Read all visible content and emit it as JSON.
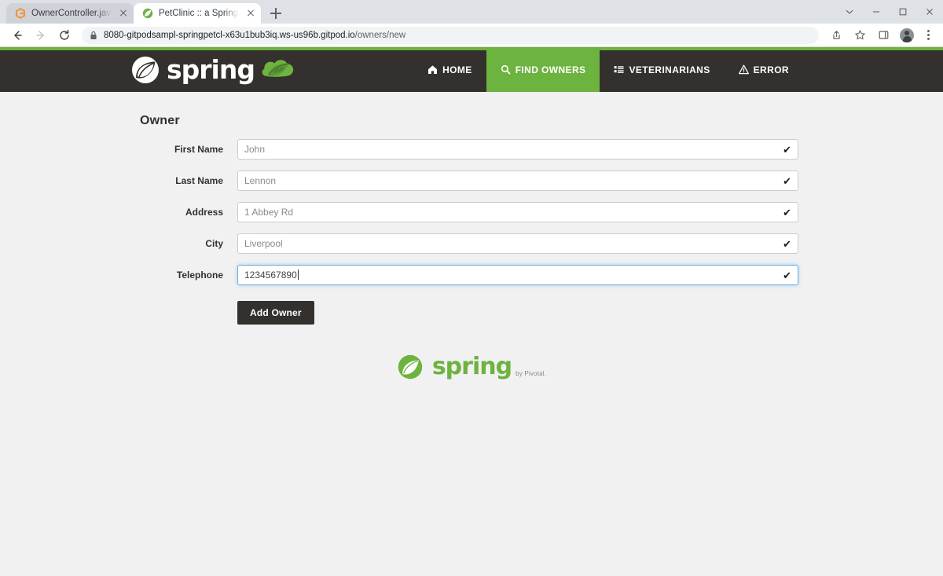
{
  "browser": {
    "tabs": [
      {
        "title": "OwnerController.java - spring-pe",
        "favicon": "gitpod-icon",
        "active": false
      },
      {
        "title": "PetClinic :: a Spring Framework d",
        "favicon": "spring-leaf-icon",
        "active": true
      }
    ],
    "new_tab_label": "+",
    "window_controls": [
      "chevron-down-icon",
      "minimize-icon",
      "maximize-icon",
      "close-icon"
    ],
    "nav_buttons": [
      "back-icon",
      "forward-icon",
      "reload-icon"
    ],
    "omnibox": {
      "lock_icon": "lock-icon",
      "host": "8080-gitpodsampl-springpetcl-x63u1bub3iq.ws-us96b.gitpod.io",
      "path": "/owners/new"
    },
    "toolbar_icons": [
      "share-icon",
      "bookmark-star-icon",
      "sidepanel-icon",
      "avatar",
      "kebab-menu-icon"
    ]
  },
  "site": {
    "brand": {
      "wordmark": "spring",
      "logo_icon": "spring-leaf-icon",
      "leaf_icon": "spring-leaf-cloud-icon"
    },
    "nav": [
      {
        "label": "HOME",
        "icon": "home-icon",
        "active": false
      },
      {
        "label": "FIND OWNERS",
        "icon": "search-icon",
        "active": true
      },
      {
        "label": "VETERINARIANS",
        "icon": "list-icon",
        "active": false
      },
      {
        "label": "ERROR",
        "icon": "warning-triangle-icon",
        "active": false
      }
    ],
    "colors": {
      "accent_green": "#6db33f",
      "navbar_dark": "#34302d",
      "page_bg": "#f1f1f1",
      "focus_blue": "#66afe9"
    }
  },
  "page": {
    "title": "Owner",
    "fields": [
      {
        "label": "First Name",
        "value": "John",
        "valid_icon": "checkmark-icon",
        "focused": false
      },
      {
        "label": "Last Name",
        "value": "Lennon",
        "valid_icon": "checkmark-icon",
        "focused": false
      },
      {
        "label": "Address",
        "value": "1 Abbey Rd",
        "valid_icon": "checkmark-icon",
        "focused": false
      },
      {
        "label": "City",
        "value": "Liverpool",
        "valid_icon": "checkmark-icon",
        "focused": false
      },
      {
        "label": "Telephone",
        "value": "1234567890",
        "valid_icon": "checkmark-icon",
        "focused": true
      }
    ],
    "submit_label": "Add Owner",
    "checkmark": "✔"
  },
  "footer": {
    "wordmark": "spring",
    "byline": "by Pivotal.",
    "logo_icon": "spring-leaf-icon"
  }
}
